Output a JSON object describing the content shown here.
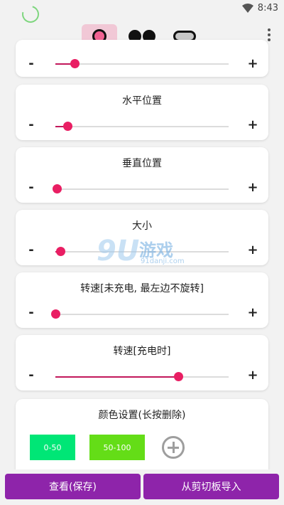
{
  "status": {
    "time": "8:43"
  },
  "toolbar": {
    "modes": [
      "ring-mode",
      "dots-mode",
      "pill-mode"
    ]
  },
  "sliders": [
    {
      "title": "",
      "value": 0.11
    },
    {
      "title": "水平位置",
      "value": 0.07
    },
    {
      "title": "垂直位置",
      "value": 0.01
    },
    {
      "title": "大小",
      "value": 0.03
    },
    {
      "title": "转速[未充电, 最左边不旋转]",
      "value": 0.0
    },
    {
      "title": "转速[充电时]",
      "value": 0.71
    }
  ],
  "controls": {
    "minus": "-",
    "plus": "+"
  },
  "colors": {
    "title": "颜色设置(长按删除)",
    "items": [
      {
        "label": "0-50",
        "color": "#00e676"
      },
      {
        "label": "50-100",
        "color": "#64dd17"
      }
    ]
  },
  "watermark": {
    "big": "9U",
    "cn": "游戏",
    "url": "91danji.com"
  },
  "buttons": {
    "view_save": "查看(保存)",
    "import_clipboard": "从剪切板导入"
  },
  "accent": "#8e24aa",
  "slider_color": "#e91e63"
}
